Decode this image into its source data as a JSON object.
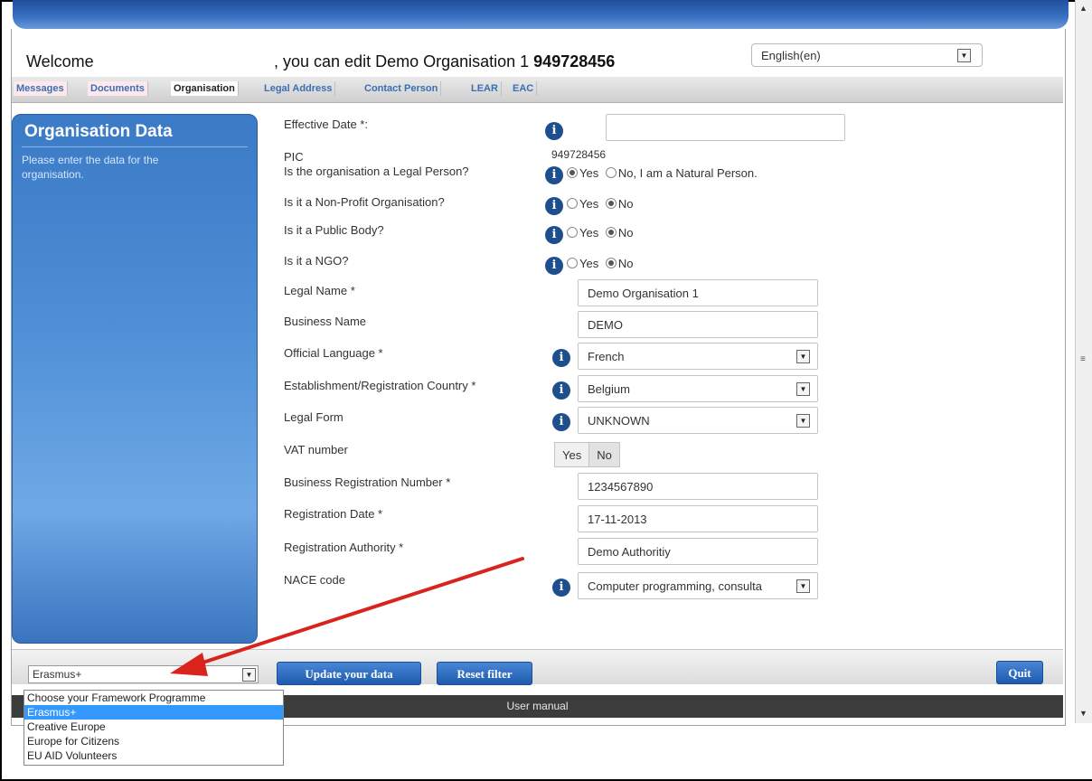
{
  "header": {
    "welcome": "Welcome",
    "edit_prefix": ", you can edit Demo Organisation 1",
    "edit_pic": "949728456",
    "language_select": "English(en)"
  },
  "tabs": [
    {
      "label": "Messages"
    },
    {
      "label": "Documents"
    },
    {
      "label": "Organisation"
    },
    {
      "label": "Legal Address"
    },
    {
      "label": "Contact Person"
    },
    {
      "label": "LEAR"
    },
    {
      "label": "EAC"
    }
  ],
  "sidebar": {
    "title": "Organisation Data",
    "text": "Please enter the data for the organisation."
  },
  "form": {
    "effective_date": {
      "label": "Effective Date *:",
      "value": ""
    },
    "pic": {
      "label": "PIC",
      "value": "949728456"
    },
    "legal_person": {
      "label": "Is the organisation a Legal Person?",
      "yes": "Yes",
      "no": "No, I am a Natural Person."
    },
    "non_profit": {
      "label": "Is it a Non-Profit Organisation?",
      "yes": "Yes",
      "no": "No"
    },
    "public_body": {
      "label": "Is it a Public Body?",
      "yes": "Yes",
      "no": "No"
    },
    "ngo": {
      "label": "Is it a NGO?",
      "yes": "Yes",
      "no": "No"
    },
    "legal_name": {
      "label": "Legal Name *",
      "value": "Demo Organisation 1"
    },
    "business_name": {
      "label": "Business Name",
      "value": "DEMO"
    },
    "official_language": {
      "label": "Official Language *",
      "value": "French"
    },
    "country": {
      "label": "Establishment/Registration Country *",
      "value": "Belgium"
    },
    "legal_form": {
      "label": "Legal Form",
      "value": "UNKNOWN"
    },
    "vat": {
      "label": "VAT number",
      "yes": "Yes",
      "no": "No"
    },
    "business_reg_number": {
      "label": "Business Registration Number *",
      "value": "1234567890"
    },
    "registration_date": {
      "label": "Registration Date *",
      "value": "17-11-2013"
    },
    "registration_authority": {
      "label": "Registration Authority *",
      "value": "Demo Authoritiy"
    },
    "nace": {
      "label": "NACE code",
      "value": "Computer programming, consulta"
    }
  },
  "bottom": {
    "framework_select": "Erasmus+",
    "update_button": "Update your data",
    "reset_button": "Reset filter",
    "quit_button": "Quit",
    "user_manual": "User manual"
  },
  "framework_options": [
    "Choose your Framework Programme",
    "Erasmus+",
    "Creative Europe",
    "Europe for Citizens",
    "EU AID Volunteers"
  ],
  "colors": {
    "accent": "#1e5aae",
    "tab_text": "#3a6fb5",
    "highlight": "#3399ff",
    "annotation_arrow": "#d9231d"
  }
}
